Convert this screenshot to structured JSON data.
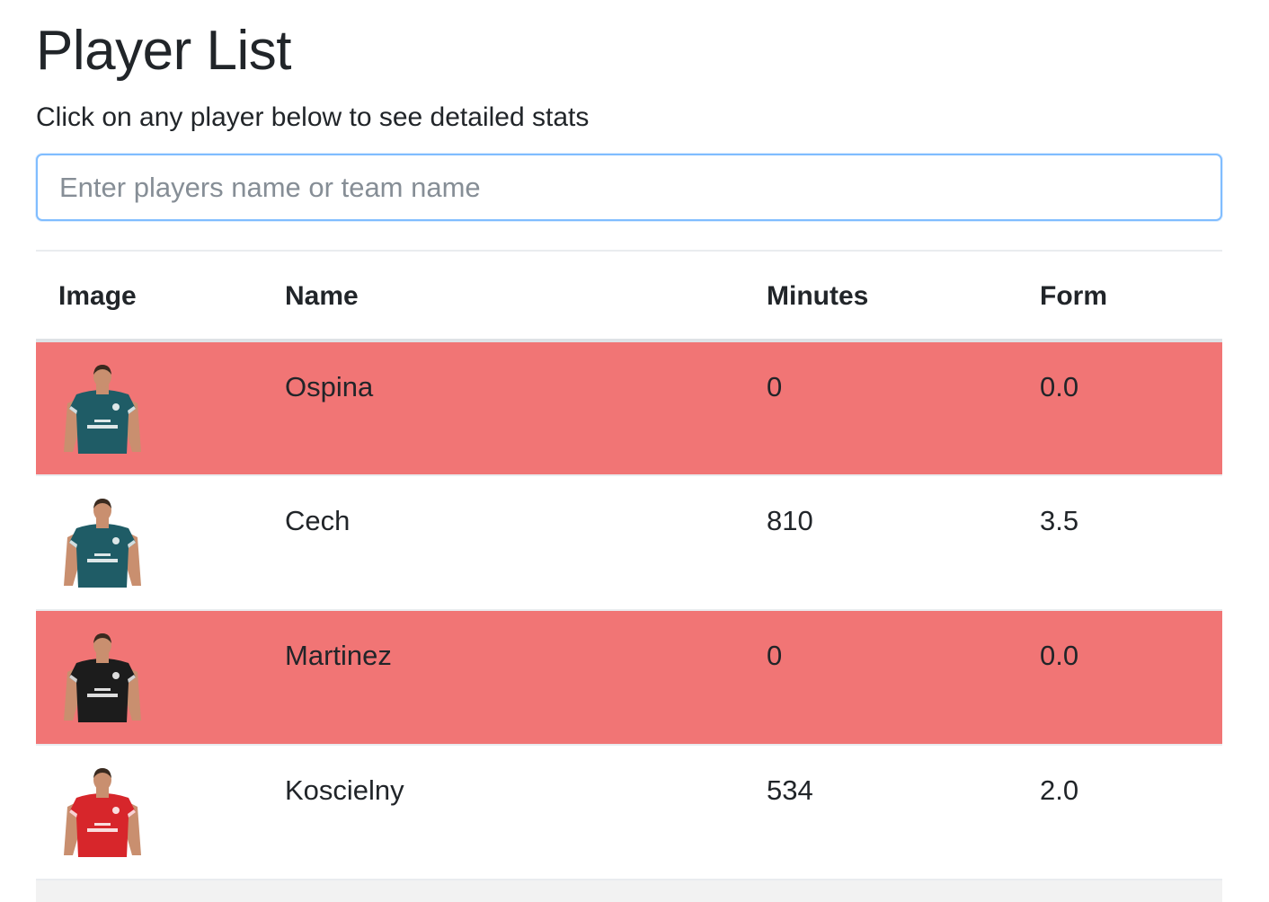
{
  "page": {
    "title": "Player List",
    "subtitle": "Click on any player below to see detailed stats"
  },
  "search": {
    "placeholder": "Enter players name or team name",
    "value": ""
  },
  "table": {
    "headers": [
      "Image",
      "Name",
      "Minutes",
      "Form"
    ],
    "rows": [
      {
        "name": "Ospina",
        "minutes": "0",
        "form": "0.0",
        "highlighted": true,
        "shirt_color": "#1f5c66",
        "shorts_color": "#1f5c66"
      },
      {
        "name": "Cech",
        "minutes": "810",
        "form": "3.5",
        "highlighted": false,
        "shirt_color": "#1f5c66",
        "shorts_color": "#1f5c66"
      },
      {
        "name": "Martinez",
        "minutes": "0",
        "form": "0.0",
        "highlighted": true,
        "shirt_color": "#1c1c1c",
        "shorts_color": "#1c1c1c"
      },
      {
        "name": "Koscielny",
        "minutes": "534",
        "form": "2.0",
        "highlighted": false,
        "shirt_color": "#d7262b",
        "shorts_color": "#ffffff"
      }
    ]
  },
  "colors": {
    "highlight_row": "#f17575",
    "search_focus_border": "#80bdff"
  }
}
